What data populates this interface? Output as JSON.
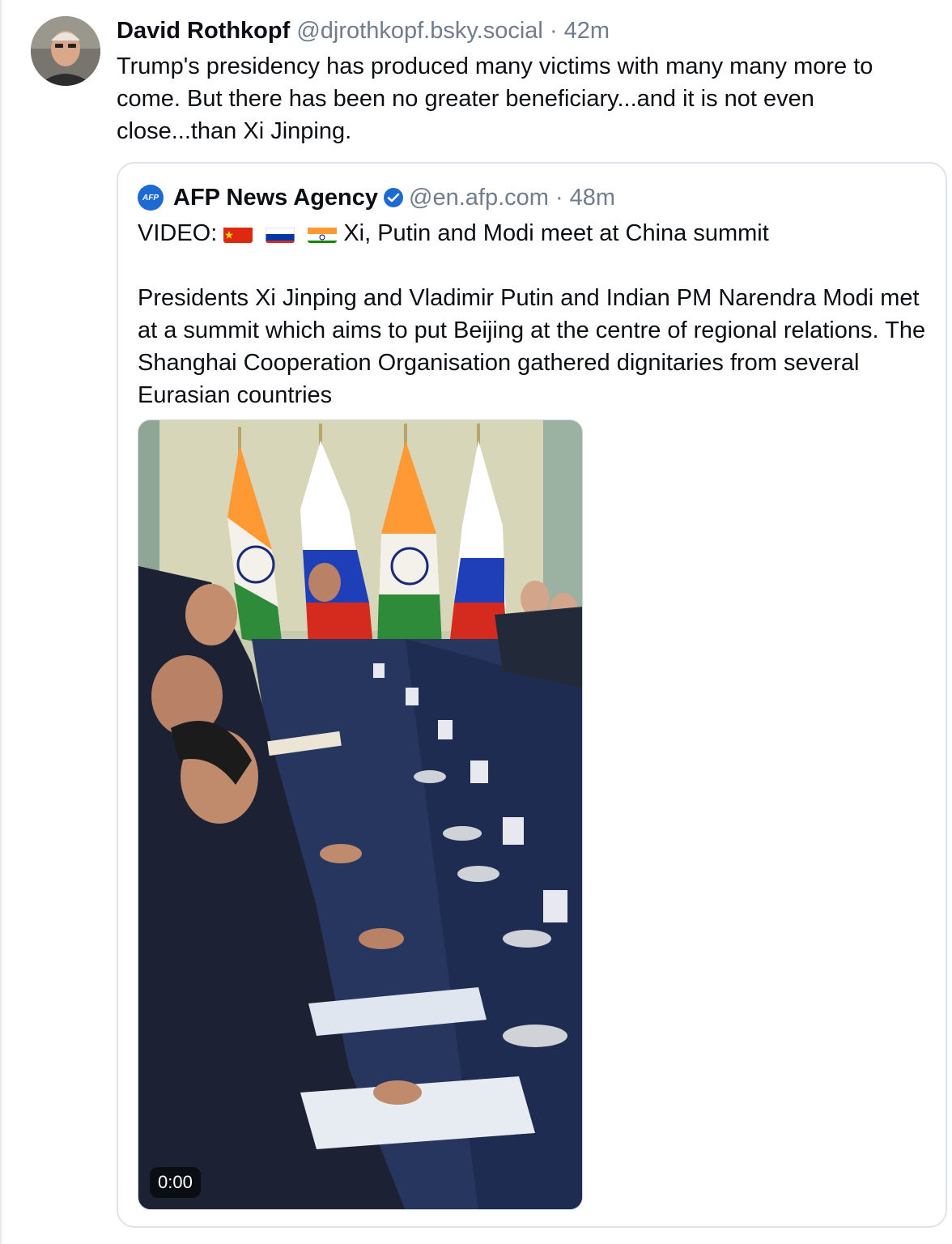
{
  "post": {
    "author_name": "David Rothkopf",
    "handle": "@djrothkopf.bsky.social",
    "separator": "·",
    "time": "42m",
    "text": "Trump's presidency has produced many victims with many many more to come. But there has been no greater beneficiary...and it is not even close...than Xi Jinping.",
    "avatar_icon": "author-avatar"
  },
  "quote": {
    "logo_text": "AFP",
    "author_name": "AFP News Agency",
    "verified_icon": "verified-check-icon",
    "handle": "@en.afp.com",
    "separator": "·",
    "time": "48m",
    "title_prefix": "VIDEO:",
    "flags": [
      "china-flag",
      "russia-flag",
      "india-flag"
    ],
    "title_suffix": "Xi, Putin and Modi meet at China summit",
    "body": "Presidents Xi Jinping and Vladimir Putin and Indian PM Narendra Modi met at a summit which aims to put Beijing at the centre of regional relations. The Shanghai Cooperation Organisation gathered dignitaries from several Eurasian countries",
    "video": {
      "duration": "0:00"
    }
  },
  "colors": {
    "accent_blue": "#1d6bd2",
    "muted_text": "#6f7d8c",
    "border": "#dfe3e8"
  }
}
